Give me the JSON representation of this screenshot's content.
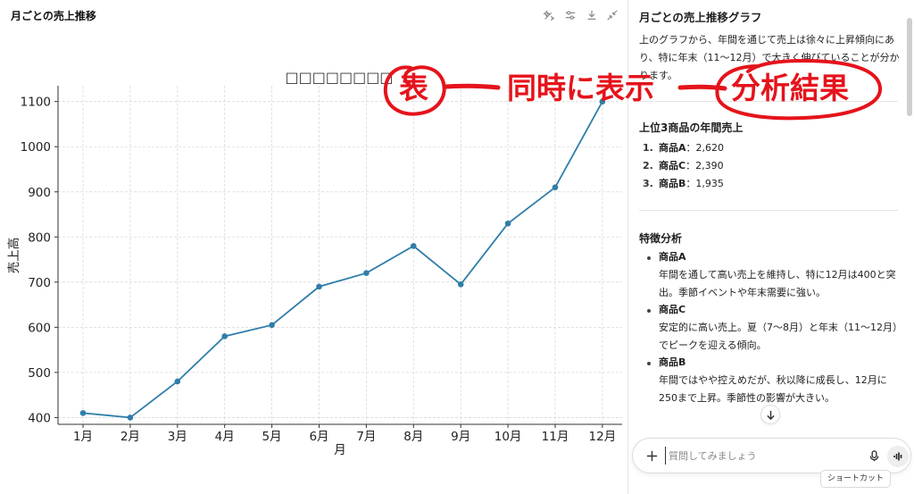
{
  "left_panel": {
    "title": "月ごとの売上推移",
    "icons": [
      "sparkle-edit-icon",
      "sliders-icon",
      "download-icon",
      "collapse-icon"
    ]
  },
  "chart_data": {
    "type": "line",
    "title": "□□□□□□□□",
    "xlabel": "月",
    "ylabel": "売上高",
    "categories": [
      "1月",
      "2月",
      "3月",
      "4月",
      "5月",
      "6月",
      "7月",
      "8月",
      "9月",
      "10月",
      "11月",
      "12月"
    ],
    "series": [
      {
        "values": [
          410,
          400,
          480,
          580,
          605,
          690,
          720,
          780,
          695,
          830,
          910,
          1100
        ]
      }
    ],
    "yticks": [
      400,
      500,
      600,
      700,
      800,
      900,
      1000,
      1100
    ],
    "ylim": [
      385,
      1135
    ],
    "grid": true,
    "line_color": "#2f7ea9",
    "legend": "none"
  },
  "annotation": {
    "left": "表",
    "middle": "同時に表示",
    "right": "分析結果",
    "color": "#e5131b"
  },
  "right_panel": {
    "heading": "月ごとの売上推移グラフ",
    "intro_lines": [
      "上のグラフから、年間を通じて売上は徐々に上昇傾向にあ",
      "り、特に年末（11〜12月）で大きく伸びていることが分か",
      "ります。"
    ],
    "top3_heading": "上位3商品の年間売上",
    "top3": [
      {
        "num": "1.",
        "name": "商品A",
        "value": "：2,620"
      },
      {
        "num": "2.",
        "name": "商品C",
        "value": "：2,390"
      },
      {
        "num": "3.",
        "name": "商品B",
        "value": "：1,935"
      }
    ],
    "features_heading": "特徴分析",
    "features": [
      {
        "name": "商品A",
        "lines": [
          "年間を通して高い売上を維持し、特に12月は400と突",
          "出。季節イベントや年末需要に強い。"
        ]
      },
      {
        "name": "商品C",
        "lines": [
          "安定的に高い売上。夏（7〜8月）と年末（11〜12月）",
          "でピークを迎える傾向。"
        ]
      },
      {
        "name": "商品B",
        "lines": [
          "年間ではやや控えめだが、秋以降に成長し、12月に",
          "250まで上昇。季節性の影響が大きい。"
        ]
      }
    ]
  },
  "chat": {
    "placeholder": "質問してみましょう",
    "shortcut_label": "ショートカット"
  }
}
